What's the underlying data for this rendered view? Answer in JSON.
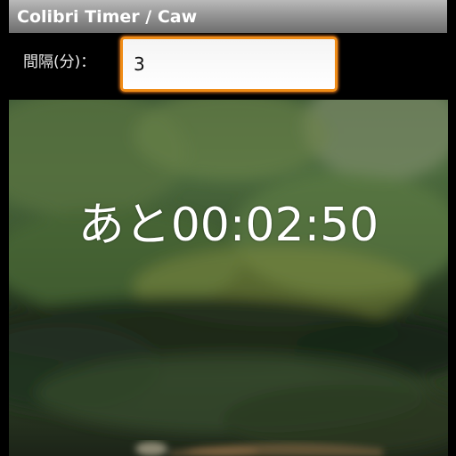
{
  "app": {
    "title": "Colibri Timer / Caw"
  },
  "interval": {
    "label": "間隔(分)：",
    "value": "3"
  },
  "timer": {
    "countdown": "あと00:02:50"
  }
}
